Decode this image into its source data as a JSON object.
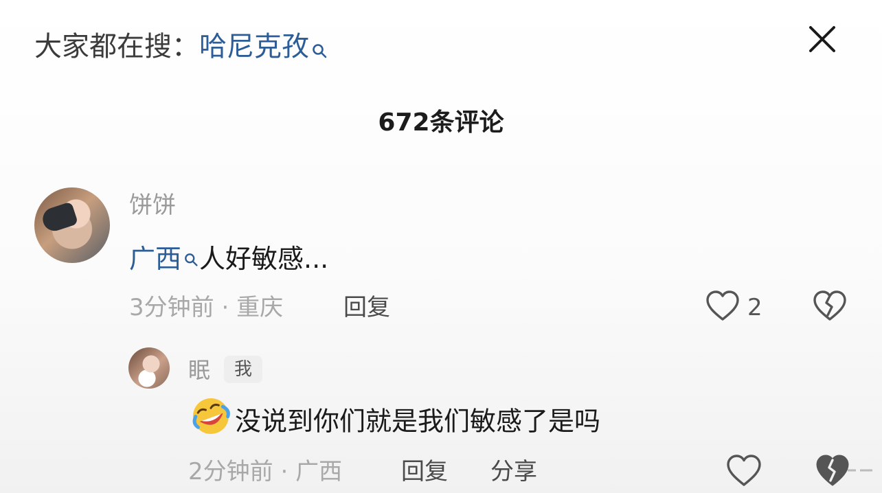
{
  "header": {
    "search_prefix": "大家都在搜：",
    "search_term": "哈尼克孜",
    "close_icon": "close-icon"
  },
  "comments_header": {
    "count_label": "672条评论"
  },
  "comments": [
    {
      "username": "饼饼",
      "text_link": "广西",
      "text_rest": "人好敏感...",
      "time": "3分钟前",
      "location": "重庆",
      "reply_label": "回复",
      "like_count": "2"
    }
  ],
  "reply": {
    "username": "眠",
    "badge": "我",
    "emoji": "rolling-on-floor-laughing",
    "text": "没说到你们就是我们敏感了是吗",
    "time": "2分钟前",
    "location": "广西",
    "reply_label": "回复",
    "share_label": "分享"
  },
  "colors": {
    "link": "#2d5d96",
    "meta": "#a8a8a8",
    "text": "#1a1a1a"
  }
}
